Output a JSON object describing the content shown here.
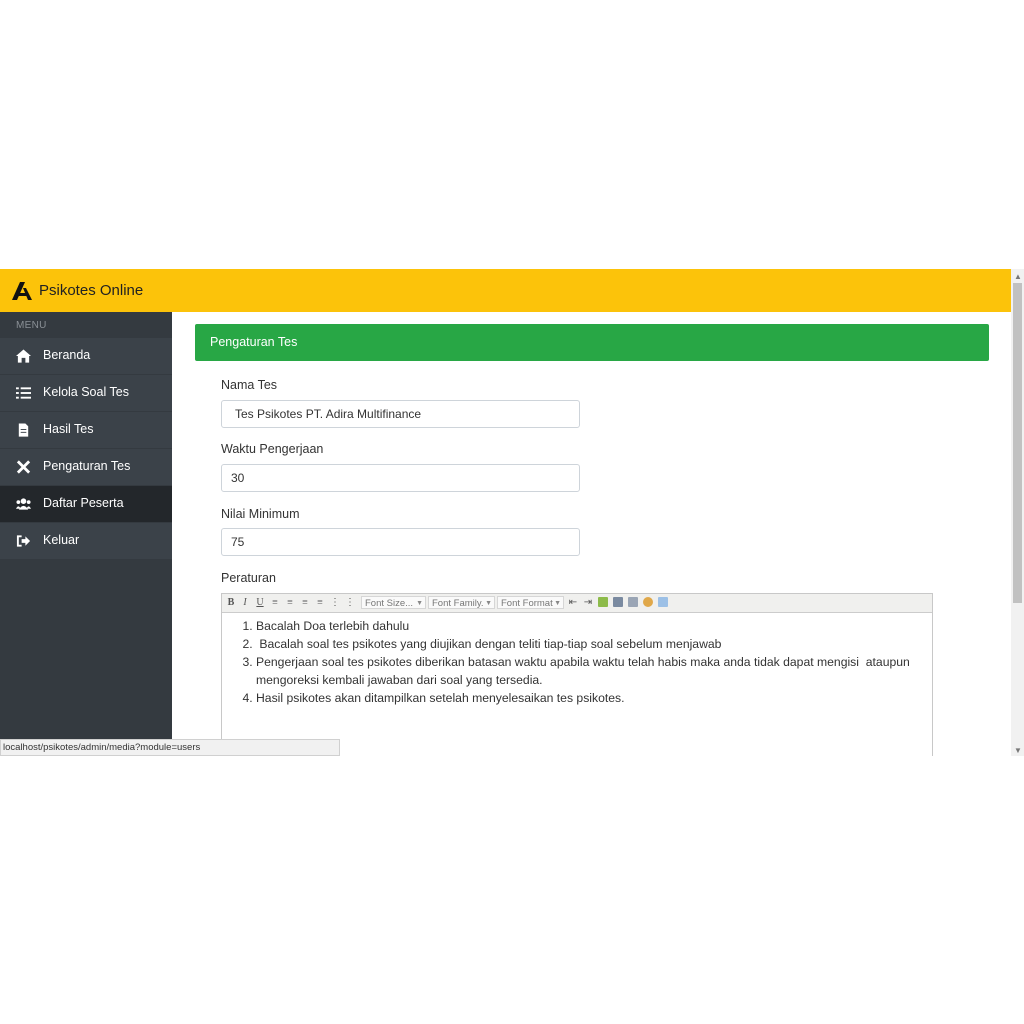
{
  "app": {
    "title": "Psikotes Online"
  },
  "sidebar": {
    "header": "MENU",
    "items": [
      {
        "label": "Beranda",
        "icon": "home-icon"
      },
      {
        "label": "Kelola Soal Tes",
        "icon": "list-icon"
      },
      {
        "label": "Hasil Tes",
        "icon": "file-icon"
      },
      {
        "label": "Pengaturan Tes",
        "icon": "tools-icon"
      },
      {
        "label": "Daftar Peserta",
        "icon": "users-icon",
        "active": true
      },
      {
        "label": "Keluar",
        "icon": "sign-out-icon"
      }
    ]
  },
  "panel": {
    "title": "Pengaturan Tes"
  },
  "form": {
    "nama_tes": {
      "label": "Nama Tes",
      "value": "Tes Psikotes PT. Adira Multifinance"
    },
    "waktu": {
      "label": "Waktu Pengerjaan",
      "value": "30"
    },
    "nilai": {
      "label": "Nilai Minimum",
      "value": "75"
    },
    "peraturan": {
      "label": "Peraturan",
      "toolbar": {
        "font_size": "Font Size...",
        "font_family": "Font Family.",
        "font_format": "Font Format"
      },
      "rules": [
        "Bacalah Doa terlebih dahulu",
        " Bacalah soal tes psikotes yang diujikan dengan teliti tiap-tiap soal sebelum menjawab",
        "Pengerjaan soal tes psikotes diberikan batasan waktu apabila waktu telah habis maka anda tidak dapat mengisi  ataupun mengoreksi kembali jawaban dari soal yang tersedia.",
        "Hasil psikotes akan ditampilkan setelah menyelesaikan tes psikotes."
      ]
    }
  },
  "statusbar": {
    "url": "localhost/psikotes/admin/media?module=users"
  },
  "colors": {
    "topbar": "#fcc30a",
    "sidebar": "#343a40",
    "panel_header": "#28a745"
  }
}
